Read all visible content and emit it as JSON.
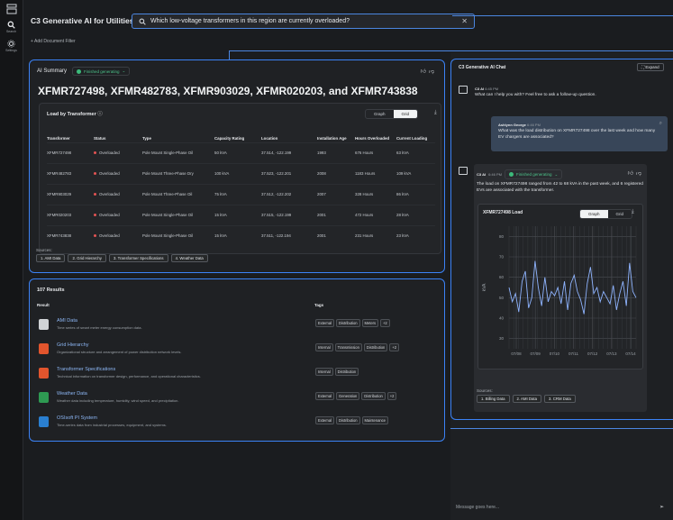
{
  "rail": {
    "search": "Search",
    "settings": "Settings"
  },
  "app": {
    "title": "C3 Generative AI for Utilities"
  },
  "search": {
    "query": "Which low-voltage transformers in this region are currently overloaded?"
  },
  "filter": {
    "add": "+ Add Document Filter"
  },
  "summary": {
    "label": "AI Summary",
    "status": "Finished generating",
    "title": "XFMR727498, XFMR482783, XFMR903029, XFMR020203, and XFMR743838",
    "card_title": "Load by Transformer",
    "graph": "Graph",
    "grid": "Grid",
    "columns": [
      "Transformer",
      "Status",
      "Type",
      "Capacity Rating",
      "Location",
      "Installation Age",
      "Hours Overloaded",
      "Current Loading"
    ],
    "rows": [
      [
        "XFMR727498",
        "Overloaded",
        "Pole Mount Single-Phase Oil",
        "50 kVA",
        "37.514, -122.199",
        "1993",
        "676 Hours",
        "63 kVA"
      ],
      [
        "XFMR482783",
        "Overloaded",
        "Pole Mount Three-Phase Dry",
        "100 kVA",
        "37.523, -122.201",
        "2008",
        "1183 Hours",
        "109 kVA"
      ],
      [
        "XFMR903029",
        "Overloaded",
        "Pole Mount Three-Phase Oil",
        "75 kVA",
        "37.512, -122.202",
        "2007",
        "328 Hours",
        "86 kVA"
      ],
      [
        "XFMR020203",
        "Overloaded",
        "Pole Mount Single-Phase Oil",
        "15 kVA",
        "37.515, -122.199",
        "2001",
        "472 Hours",
        "28 kVA"
      ],
      [
        "XFMR743838",
        "Overloaded",
        "Pole Mount Single-Phase Oil",
        "15 kVA",
        "37.511, -122.194",
        "2001",
        "231 Hours",
        "23 kVA"
      ]
    ],
    "sources_label": "Sources:",
    "sources": [
      "1. AMI Data",
      "2. Grid Hierarchy",
      "3. Transformer Specifications",
      "4. Weather Data"
    ]
  },
  "results": {
    "count": "107 Results",
    "col_result": "Result",
    "col_tags": "Tags",
    "items": [
      {
        "name": "AMI Data",
        "desc": "Time series of smart meter energy consumption data.",
        "tags": [
          "External",
          "Distribution",
          "Meters",
          "+2"
        ],
        "icon": "doc-icon",
        "color": "#d0d3d6"
      },
      {
        "name": "Grid Hierarchy",
        "desc": "Organizational structure and arrangement of power distribution network levels.",
        "tags": [
          "Internal",
          "Transmission",
          "Distribution",
          "+2"
        ],
        "icon": "pdf-icon",
        "color": "#e2552d"
      },
      {
        "name": "Transformer Specifications",
        "desc": "Technical information on transformer design, performance, and operational characteristics.",
        "tags": [
          "Internal",
          "Distribution"
        ],
        "icon": "pdf-icon",
        "color": "#e2552d"
      },
      {
        "name": "Weather Data",
        "desc": "Weather data including temperature, humidity, wind speed, and precipitation.",
        "tags": [
          "External",
          "Generation",
          "Distribution",
          "+2"
        ],
        "icon": "sheet-icon",
        "color": "#2e9a52"
      },
      {
        "name": "OSIsoft PI System",
        "desc": "Time-series data from industrial processes, equipment, and systems.",
        "tags": [
          "External",
          "Distribution",
          "Maintenance"
        ],
        "icon": "pi-icon",
        "color": "#2a7fd0"
      }
    ]
  },
  "chat": {
    "title": "C3 Generative AI Chat",
    "expand": "Expand",
    "m1": {
      "who": "C3 AI",
      "time": "6:45 PM",
      "text": "What can I help you with? Feel free to ask a follow-up question."
    },
    "m2": {
      "who": "Ashlynn George",
      "time": "6:46 PM",
      "text": "What was the load distribution on XFMR727498 over the last week and how many EV chargers are associated?"
    },
    "m3": {
      "who": "C3 AI",
      "time": "6:46 PM",
      "status": "Finished generating",
      "text": "The load on XFMR727498 ranged from 42 to 68 kVA in the past week, and 6 registered EVs are associated with the transformer.",
      "chart_title": "XFMR727498 Load",
      "graph": "Graph",
      "grid": "Grid",
      "sources_label": "Sources:",
      "sources": [
        "1. Billing Data",
        "2. AMI Data",
        "3. CRM Data"
      ]
    },
    "placeholder": "Message goes here..."
  },
  "chart_data": {
    "type": "line",
    "title": "XFMR727498 Load",
    "ylabel": "kVA",
    "ylim": [
      25,
      85
    ],
    "yticks": [
      30,
      40,
      50,
      60,
      70,
      80
    ],
    "xticks": [
      "07/08",
      "07/09",
      "07/10",
      "07/11",
      "07/12",
      "07/13",
      "07/14"
    ],
    "grid": true,
    "series": [
      {
        "values": [
          55,
          48,
          52,
          43,
          58,
          63,
          45,
          50,
          68,
          55,
          46,
          60,
          48,
          53,
          51,
          55,
          47,
          58,
          44,
          57,
          61,
          53,
          49,
          42,
          57,
          65,
          52,
          55,
          48,
          53,
          50,
          47,
          56,
          44,
          52,
          58,
          46,
          67,
          53,
          50
        ]
      }
    ]
  }
}
